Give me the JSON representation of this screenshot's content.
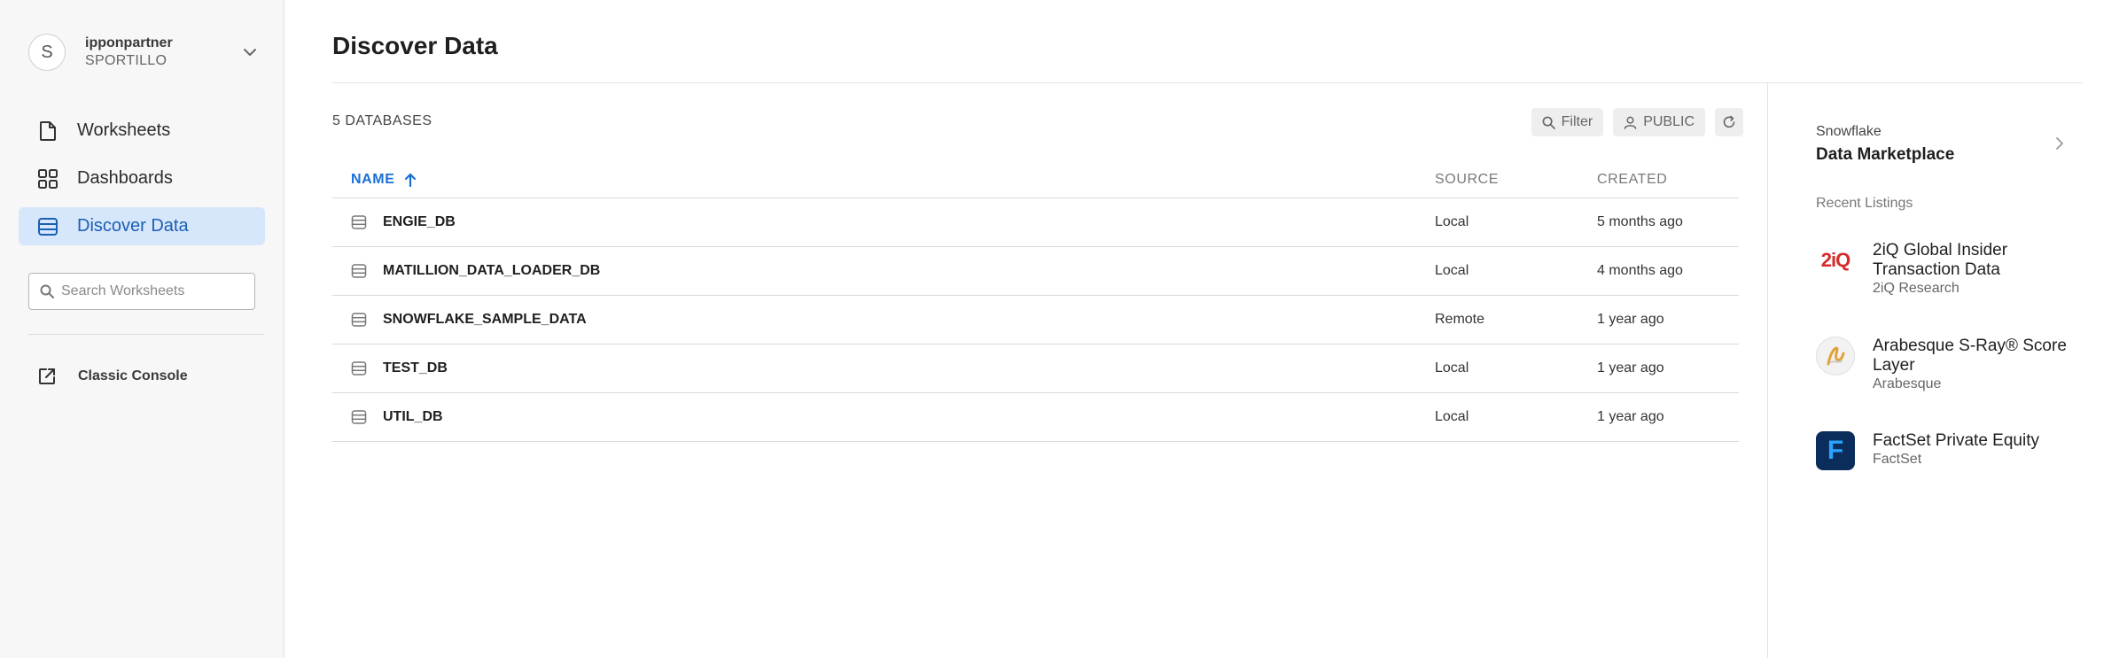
{
  "account": {
    "avatar_letter": "S",
    "name": "ipponpartner",
    "role": "SPORTILLO"
  },
  "nav": {
    "items": [
      {
        "label": "Worksheets",
        "icon": "document-icon"
      },
      {
        "label": "Dashboards",
        "icon": "grid-icon"
      },
      {
        "label": "Discover Data",
        "icon": "database-icon",
        "active": true
      }
    ],
    "search_placeholder": "Search Worksheets",
    "classic_console": "Classic Console"
  },
  "page": {
    "title": "Discover Data"
  },
  "databases": {
    "count_label": "5 DATABASES",
    "filter_label": "Filter",
    "role_label": "PUBLIC",
    "columns": {
      "name": "NAME",
      "source": "SOURCE",
      "created": "CREATED"
    },
    "rows": [
      {
        "name": "ENGIE_DB",
        "source": "Local",
        "created": "5 months ago"
      },
      {
        "name": "MATILLION_DATA_LOADER_DB",
        "source": "Local",
        "created": "4 months ago"
      },
      {
        "name": "SNOWFLAKE_SAMPLE_DATA",
        "source": "Remote",
        "created": "1 year ago"
      },
      {
        "name": "TEST_DB",
        "source": "Local",
        "created": "1 year ago"
      },
      {
        "name": "UTIL_DB",
        "source": "Local",
        "created": "1 year ago"
      }
    ]
  },
  "marketplace": {
    "brand": "Snowflake",
    "title": "Data Marketplace",
    "recent_label": "Recent Listings",
    "listings": [
      {
        "title": "2iQ Global Insider Transaction Data",
        "provider": "2iQ Research",
        "logo_text": "2iQ",
        "logo_color": "#d62b2b"
      },
      {
        "title": "Arabesque S-Ray® Score Layer",
        "provider": "Arabesque",
        "logo_color": "#e0a23a"
      },
      {
        "title": "FactSet Private Equity",
        "provider": "FactSet",
        "logo_text": "F",
        "logo_color": "#0b2d5b"
      }
    ]
  },
  "colors": {
    "accent": "#1a6fd8",
    "active_bg": "#d6e6fb",
    "sidebar_bg": "#f7f7f7"
  }
}
